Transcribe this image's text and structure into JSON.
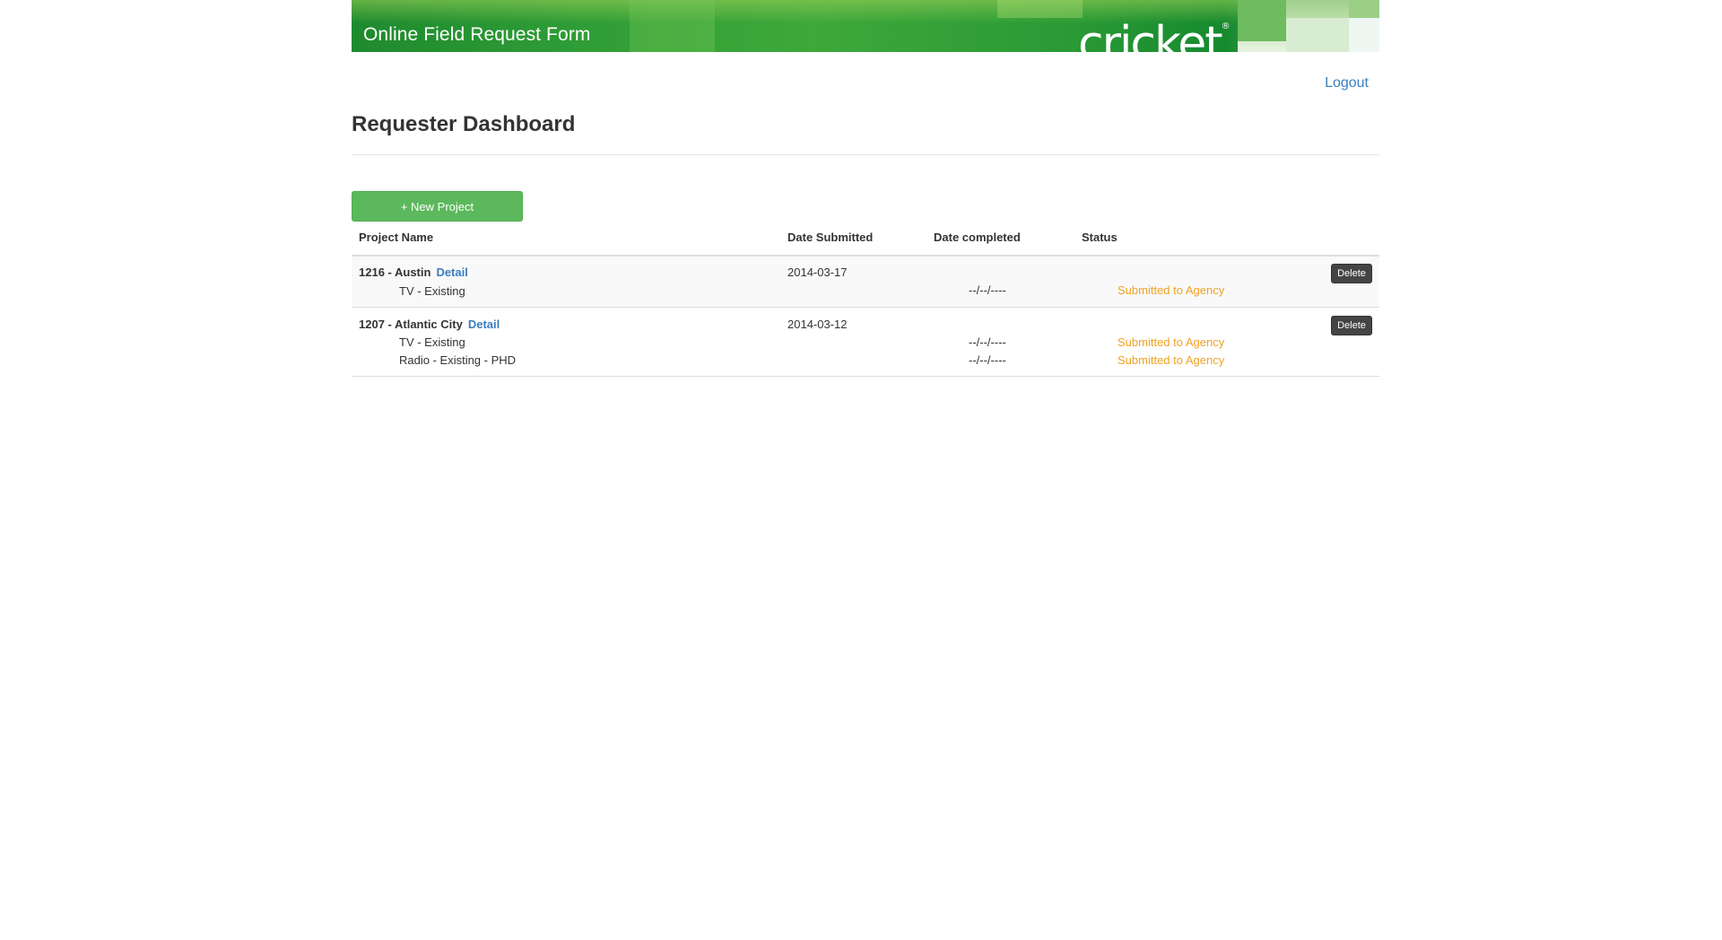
{
  "banner": {
    "title": "Online Field Request Form",
    "logo": "cricket",
    "logo_mark": "®"
  },
  "nav": {
    "logout_label": "Logout"
  },
  "page": {
    "title": "Requester Dashboard"
  },
  "actions": {
    "new_project_label": "+ New Project"
  },
  "table": {
    "headers": {
      "project_name": "Project Name",
      "date_submitted": "Date Submitted",
      "date_completed": "Date completed",
      "status": "Status"
    },
    "rows": [
      {
        "name": "1216 - Austin",
        "detail_label": "Detail",
        "date_submitted": "2014-03-17",
        "delete_label": "Delete",
        "items": [
          {
            "label": "TV - Existing",
            "date_completed": "--/--/----",
            "status": "Submitted to Agency"
          }
        ]
      },
      {
        "name": "1207 - Atlantic City",
        "detail_label": "Detail",
        "date_submitted": "2014-03-12",
        "delete_label": "Delete",
        "items": [
          {
            "label": "TV - Existing",
            "date_completed": "--/--/----",
            "status": "Submitted to Agency"
          },
          {
            "label": "Radio - Existing - PHD",
            "date_completed": "--/--/----",
            "status": "Submitted to Agency"
          }
        ]
      }
    ]
  },
  "colors": {
    "brand_green": "#2f9d36",
    "button_green": "#5cb85c",
    "link_blue": "#3a7ebf",
    "status_orange": "#f0a224",
    "delete_dark": "#444444"
  }
}
